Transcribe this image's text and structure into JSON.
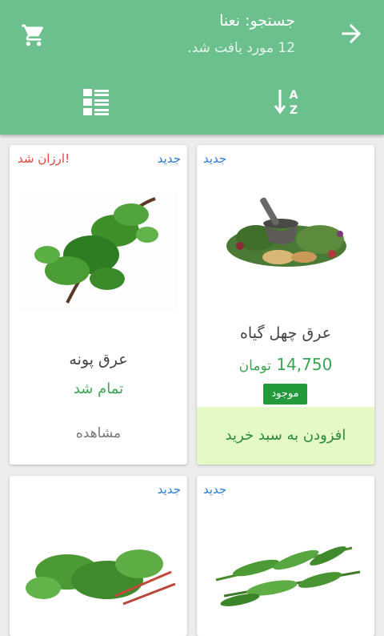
{
  "header": {
    "title": "جستجو: نعنا",
    "subtitle": "12 مورد یافت شد.",
    "back_icon": "arrow-back-icon",
    "cart_icon": "shopping-cart-icon",
    "sort_icon": "sort-alpha-icon",
    "view_icon": "list-view-icon",
    "sort_letters": [
      "A",
      "Z"
    ]
  },
  "products": [
    {
      "name": "عرق چهل گیاه",
      "badge": "جدید",
      "price_value": "14,750",
      "price_unit": "تومان",
      "stock": "موجود",
      "action": "افزودن به سبد خرید"
    },
    {
      "name": "عرق پونه",
      "badge": "جدید",
      "discount_badge": "ارزان شد!",
      "status": "تمام شد",
      "action": "مشاهده"
    },
    {
      "badge": "جدید"
    },
    {
      "badge": "جدید"
    }
  ],
  "colors": {
    "header": "#6cc08e",
    "badge_new": "#2a7bd6",
    "badge_cheap": "#e2473a",
    "price": "#3aa552",
    "stock_bg": "#259a3c",
    "add_cart_bg": "#e4f9c6"
  }
}
